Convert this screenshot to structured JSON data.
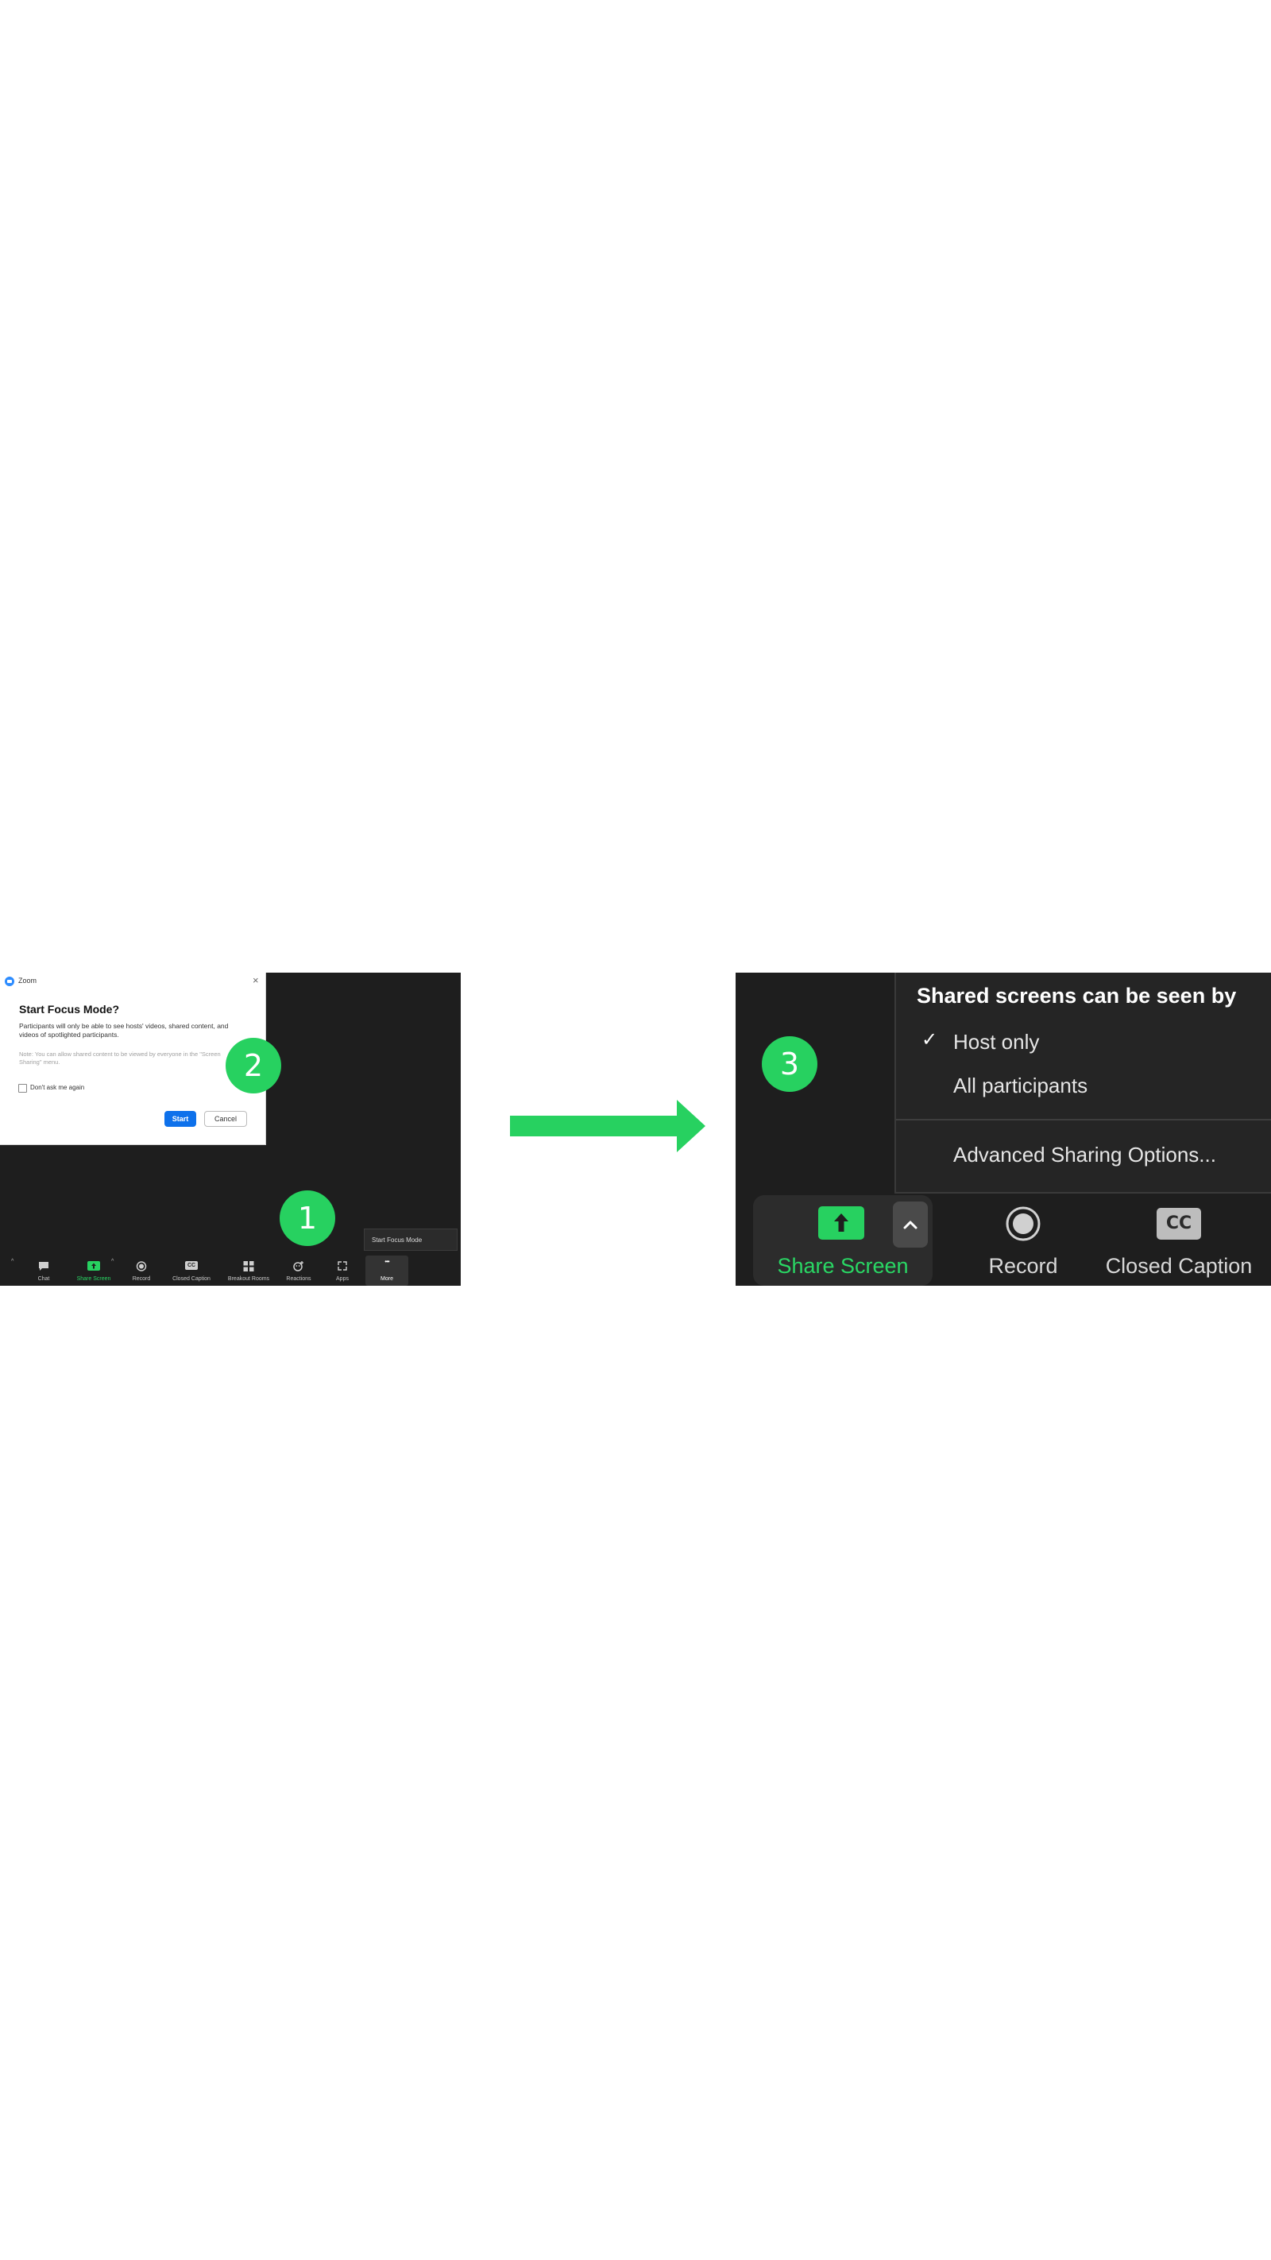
{
  "colors": {
    "accent_green": "#27d160",
    "panel_bg": "#1e1e1e",
    "menu_bg": "#252525",
    "zoom_blue": "#0e71eb"
  },
  "left_panel": {
    "dialog": {
      "app_name": "Zoom",
      "close_icon": "close-icon",
      "heading": "Start Focus Mode?",
      "body": "Participants will only be able to see hosts' videos, shared content, and videos of spotlighted participants.",
      "note": "Note: You can allow shared content to be viewed by everyone in the \"Screen Sharing\" menu.",
      "checkbox_label": "Don't ask me again",
      "start_label": "Start",
      "cancel_label": "Cancel"
    },
    "badges": [
      "1",
      "2"
    ],
    "more_menu_item": "Start Focus Mode",
    "toolbar": [
      {
        "label": "Chat",
        "icon": "chat-icon"
      },
      {
        "label": "Share Screen",
        "icon": "share-screen-icon"
      },
      {
        "label": "Record",
        "icon": "record-icon"
      },
      {
        "label": "Closed Caption",
        "icon": "cc-icon",
        "icon_text": "CC"
      },
      {
        "label": "Breakout Rooms",
        "icon": "breakout-rooms-icon"
      },
      {
        "label": "Reactions",
        "icon": "reactions-icon"
      },
      {
        "label": "Apps",
        "icon": "apps-icon"
      },
      {
        "label": "More",
        "icon": "more-icon",
        "icon_text": "•••"
      }
    ]
  },
  "arrow": {
    "icon": "right-arrow-icon",
    "color": "#27d160"
  },
  "right_panel": {
    "badge": "3",
    "share_menu": {
      "title": "Shared screens can be seen by",
      "check_icon": "check-icon",
      "options": [
        "Host only",
        "All participants"
      ],
      "selected": "Host only",
      "advanced": "Advanced Sharing Options..."
    },
    "toolbar": {
      "share_screen": "Share Screen",
      "record": "Record",
      "closed_caption": "Closed Caption",
      "cc_icon_text": "CC"
    }
  }
}
